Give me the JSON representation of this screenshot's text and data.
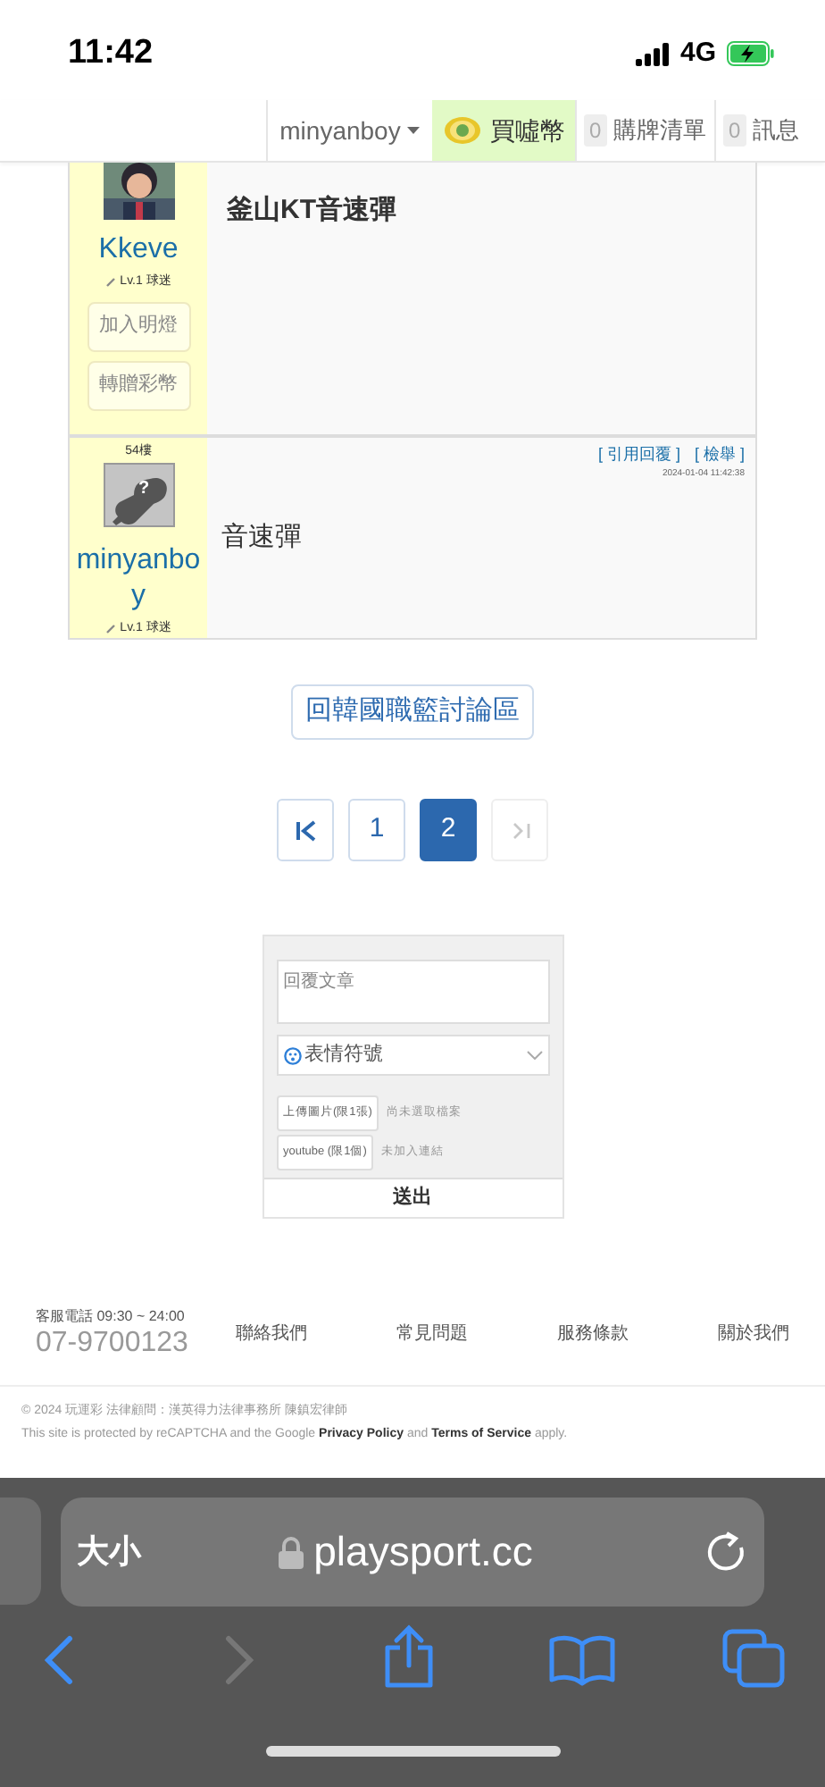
{
  "status_bar": {
    "time": "11:42",
    "network": "4G",
    "charging": true
  },
  "nav": {
    "user": "minyanboy",
    "coins": "買噓幣",
    "items": [
      {
        "count": "0",
        "label": "購牌清單"
      },
      {
        "count": "0",
        "label": "訊息"
      }
    ]
  },
  "posts": [
    {
      "username": "Kkeve",
      "level": "Lv.1 球迷",
      "body": "釜山KT音速彈",
      "body_bold": true,
      "buttons": [
        "加入明燈",
        "轉贈彩幣"
      ]
    },
    {
      "floor": "54樓",
      "avatar": {
        "kind": "default"
      },
      "avatar_mark": "?",
      "username": "minyanboy",
      "level": "Lv.1 球迷",
      "actions": [
        "[ 引用回覆 ]",
        "[ 檢舉 ]"
      ],
      "time": "2024-01-04 11:42:38",
      "body": "音速彈",
      "body_bold": false
    }
  ],
  "back_button": "回韓國職籃討論區",
  "pagination": [
    {
      "kind": "first",
      "disabled": false
    },
    {
      "kind": "page",
      "label": "1",
      "selected": false
    },
    {
      "kind": "page",
      "label": "2",
      "selected": true
    },
    {
      "kind": "last",
      "disabled": true
    }
  ],
  "reply_form": {
    "placeholder": "回覆文章",
    "emoji_select": "表情符號",
    "attachments": [
      {
        "button": "上傳圖片(限1張)",
        "status": "尚未選取檔案"
      },
      {
        "button": "youtube (限1個)",
        "status": "未加入連結"
      }
    ],
    "submit": "送出"
  },
  "footer": {
    "hotline": "客服電話 09:30 ~ 24:00",
    "phone": "07-9700123",
    "links": [
      "聯絡我們",
      "常見問題",
      "服務條款",
      "關於我們"
    ],
    "copyright": "© 2024 玩運彩 法律顧問：漢英得力法律事務所 陳鎮宏律師",
    "recaptcha": "This site is protected by reCAPTCHA and the Google **Privacy Policy** and **Terms of Service** apply."
  },
  "browser": {
    "text_size": "大小",
    "url": "playsport.cc",
    "back_enabled": true,
    "forward_enabled": false
  }
}
